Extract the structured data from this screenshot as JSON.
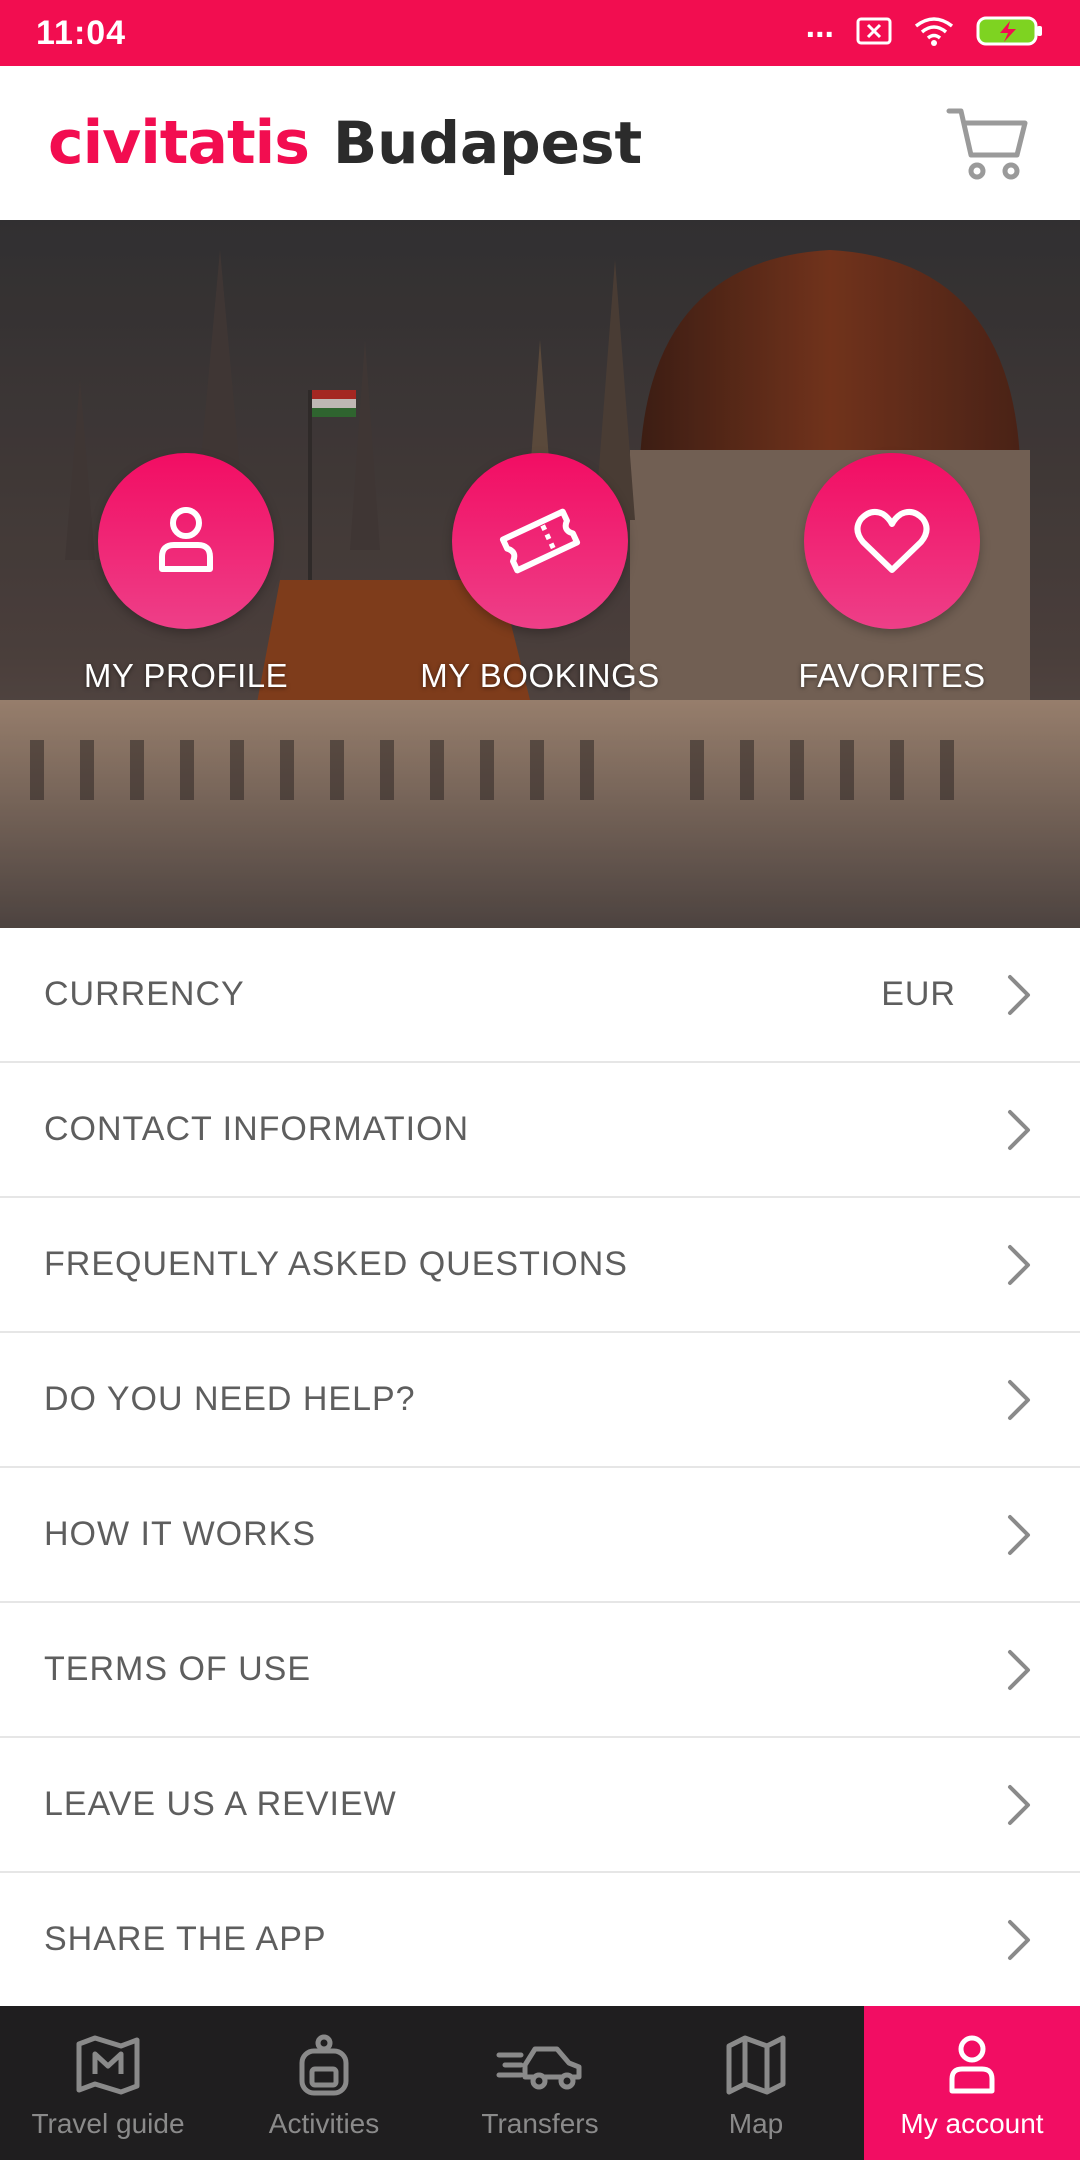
{
  "status_bar": {
    "time": "11:04",
    "dots": "..."
  },
  "header": {
    "brand": "civitatis",
    "city": "Budapest"
  },
  "hero_actions": [
    {
      "label": "MY PROFILE",
      "icon": "person-icon"
    },
    {
      "label": "MY BOOKINGS",
      "icon": "ticket-icon"
    },
    {
      "label": "FAVORITES",
      "icon": "heart-icon"
    }
  ],
  "menu": [
    {
      "label": "CURRENCY",
      "value": "EUR"
    },
    {
      "label": "CONTACT INFORMATION"
    },
    {
      "label": "FREQUENTLY ASKED QUESTIONS"
    },
    {
      "label": "DO YOU NEED HELP?"
    },
    {
      "label": "HOW IT WORKS"
    },
    {
      "label": "TERMS OF USE"
    },
    {
      "label": "LEAVE US A REVIEW"
    },
    {
      "label": "SHARE THE APP"
    }
  ],
  "bottom_nav": [
    {
      "label": "Travel guide",
      "icon": "book-map-icon",
      "active": false
    },
    {
      "label": "Activities",
      "icon": "backpack-icon",
      "active": false
    },
    {
      "label": "Transfers",
      "icon": "car-icon",
      "active": false
    },
    {
      "label": "Map",
      "icon": "map-icon",
      "active": false
    },
    {
      "label": "My account",
      "icon": "person-icon",
      "active": true
    }
  ],
  "colors": {
    "brand": "#f20d50",
    "accent": "#f20d63",
    "nav_bg": "#1f1e1f",
    "text_muted": "#5e5e5e"
  }
}
